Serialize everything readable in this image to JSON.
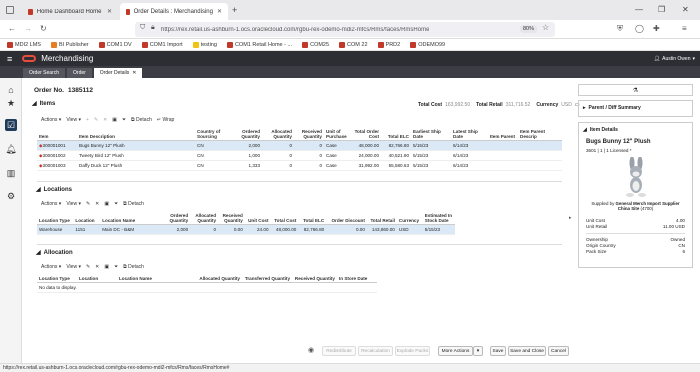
{
  "browser": {
    "tabs": [
      {
        "label": "Home Dashboard Home Dashb"
      },
      {
        "label": "Order Details : Merchandising"
      }
    ],
    "url": "https://rex.retail.us-ashburn-1.ocs.oraclecloud.com/rgbu-rex-odemo-mdi2-mfcs/Rms/faces/RmsHome",
    "zoom": "80%",
    "bookmarks": [
      {
        "label": "MDI2 LMS",
        "color": "#c0392b"
      },
      {
        "label": "BI Publisher",
        "color": "#e67e22"
      },
      {
        "label": "COM1 DV",
        "color": "#c0392b"
      },
      {
        "label": "COM1 Import",
        "color": "#c0392b"
      },
      {
        "label": "testing",
        "color": "#f1c40f"
      },
      {
        "label": "COM1 Retail Home - ...",
        "color": "#c0392b"
      },
      {
        "label": "COM25",
        "color": "#c0392b"
      },
      {
        "label": "COM 22",
        "color": "#c0392b"
      },
      {
        "label": "PRD2",
        "color": "#c0392b"
      },
      {
        "label": "ODEMO99",
        "color": "#c0392b"
      }
    ]
  },
  "app": {
    "title": "Merchandising",
    "user": "Austin Owen",
    "subtabs": [
      "Order Search",
      "Order",
      "Order Details"
    ]
  },
  "order": {
    "label": "Order No.",
    "number": "1385112",
    "totals": {
      "total_cost_label": "Total Cost",
      "total_cost": "163,992.50",
      "total_retail_label": "Total Retail",
      "total_retail": "311,716.52",
      "currency_label": "Currency",
      "currency": "USD"
    }
  },
  "items": {
    "title": "Items",
    "toolbar": {
      "actions": "Actions",
      "view": "View",
      "detach": "Detach",
      "wrap": "Wrap"
    },
    "headers": [
      "Item",
      "Item Description",
      "Country of Sourcing",
      "Ordered Quantity",
      "Allocated Quantity",
      "Received Quantity",
      "Unit of Purchase",
      "Total Order Cost",
      "Total ELC",
      "Earliest Ship Date",
      "Latest Ship Date",
      "Item Parent",
      "Item Parent Descrip"
    ],
    "rows": [
      [
        "300001001",
        "Bugs Bunny 12\" Plush",
        "CN",
        "2,000",
        "0",
        "0",
        "Case",
        "48,000.00",
        "82,766.80",
        "5/15/23",
        "6/14/23",
        "",
        ""
      ],
      [
        "300001002",
        "Tweety Bird 12\" Plush",
        "CN",
        "1,000",
        "0",
        "0",
        "Case",
        "24,000.00",
        "40,521.90",
        "5/15/23",
        "6/14/23",
        "",
        ""
      ],
      [
        "300001003",
        "Daffy Duck 12\" Plush",
        "CN",
        "1,333",
        "0",
        "0",
        "Case",
        "31,992.00",
        "55,580.63",
        "5/15/23",
        "6/14/23",
        "",
        ""
      ]
    ]
  },
  "locations": {
    "title": "Locations",
    "toolbar": {
      "actions": "Actions",
      "view": "View",
      "detach": "Detach"
    },
    "headers": [
      "Location Type",
      "Location",
      "Location Name",
      "Ordered Quantity",
      "Allocated Quantity",
      "Received Quantity",
      "Unit Cost",
      "Total Cost",
      "Total ELC",
      "Order Discount",
      "Total Retail",
      "Currency",
      "Estimated In Stock Date"
    ],
    "rows": [
      [
        "Warehouse",
        "1151",
        "Main DC - B&M",
        "2,000",
        "0",
        "0.00",
        "24.00",
        "48,000.00",
        "82,766.80",
        "0.00",
        "143,860.00",
        "USD",
        "5/15/23"
      ]
    ]
  },
  "allocation": {
    "title": "Allocation",
    "toolbar": {
      "actions": "Actions",
      "view": "View",
      "detach": "Detach"
    },
    "headers": [
      "Location Type",
      "Location",
      "Location Name",
      "Allocated Quantity",
      "Transferred Quantity",
      "Received Quantity",
      "In Store Date"
    ],
    "empty": "No data to display."
  },
  "right_panel": {
    "parent_diff": "Parent / Diff Summary",
    "item_details": "Item Details",
    "item_name": "Bugs Bunny 12\" Plush",
    "item_sub": "3601 | 1 | 1 Licensed *",
    "supplied_by_label": "Supplied by",
    "supplier": "General Merch Import Supplier China Site",
    "supplier_id": "(4700)",
    "fields": [
      {
        "label": "Unit Cost",
        "value": "4.00"
      },
      {
        "label": "Unit Retail",
        "value": "11.00 USD"
      },
      {
        "label": "Ownership",
        "value": "Owned"
      },
      {
        "label": "Origin Country",
        "value": "CN"
      },
      {
        "label": "Pack Size",
        "value": "6"
      }
    ]
  },
  "footer_buttons": {
    "redistribute": "Redistribute",
    "recalculation": "Recalculation",
    "explode_packs": "Explode Packs",
    "more_actions": "More Actions",
    "save": "Save",
    "save_close": "Save and Close",
    "cancel": "Cancel"
  },
  "status_url": "https://rex.retail.us-ashburn-1.ocs.oraclecloud.com/rgbu-rex-odemo-mdi2-mfcs/Rms/faces/RmsHome#"
}
